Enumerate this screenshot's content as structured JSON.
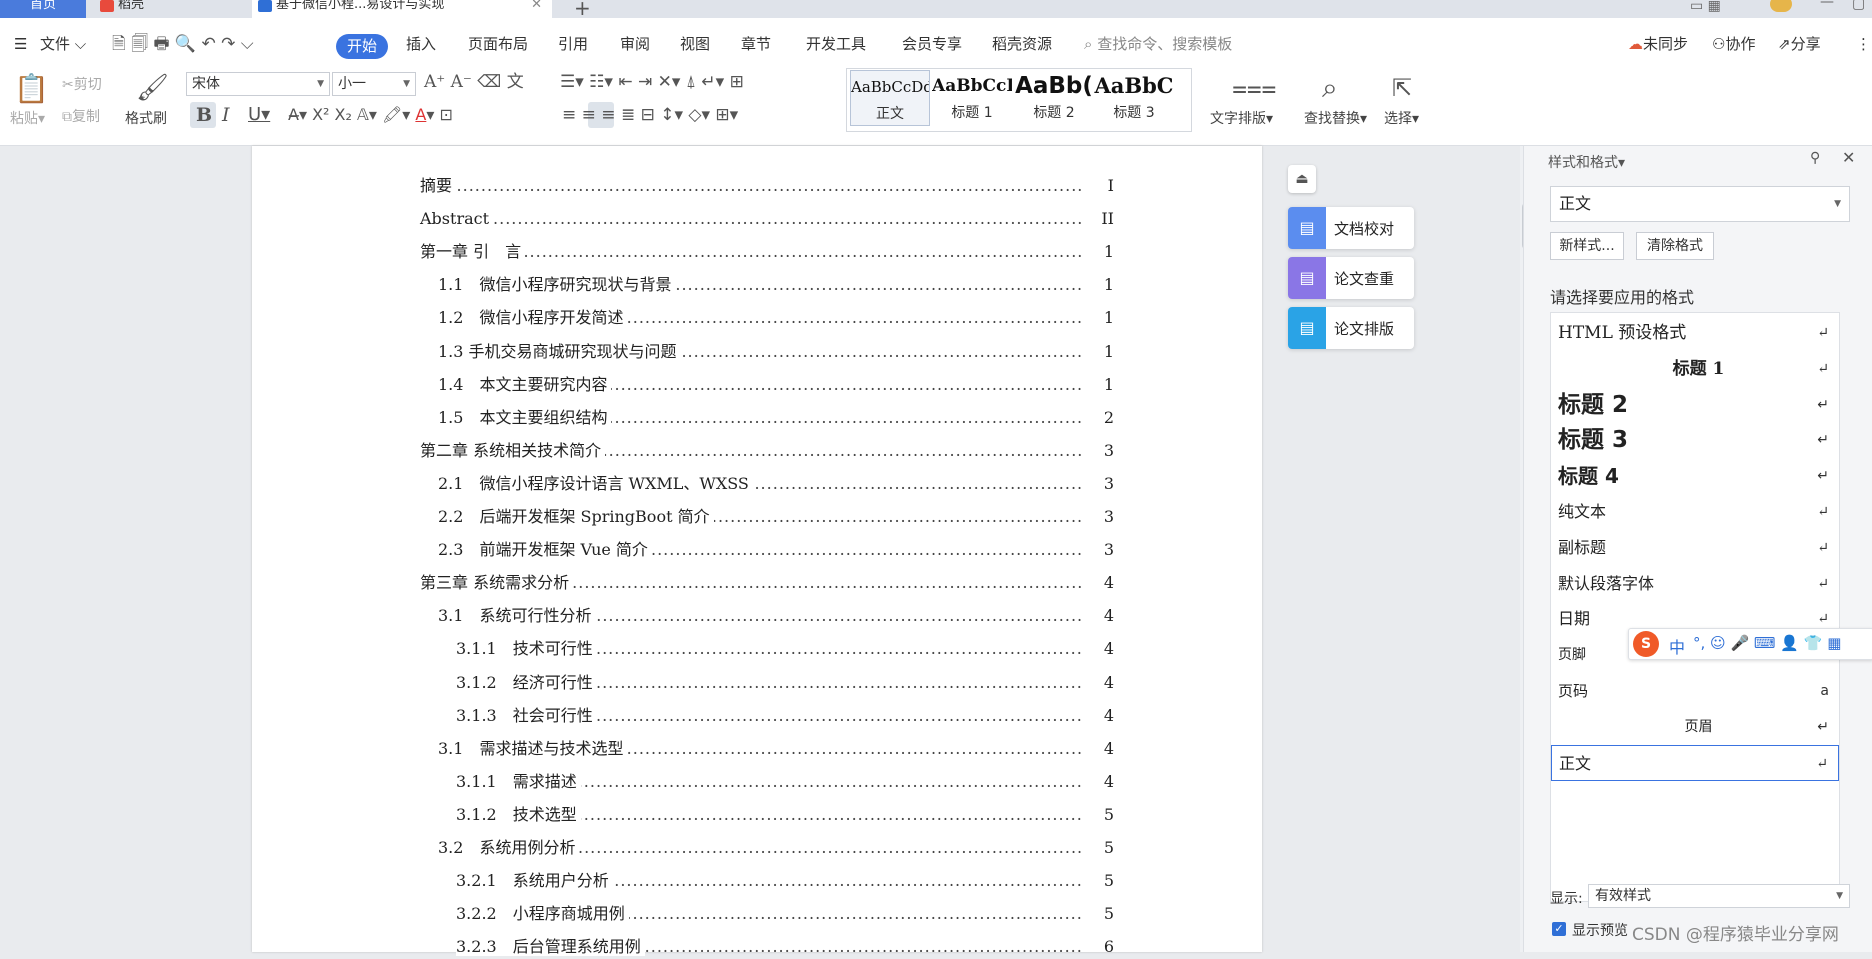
{
  "tabs": {
    "home": "首页",
    "daoke": "稻壳",
    "doc": "基于微信小程...易设计与实现"
  },
  "menu": {
    "file": "文件",
    "items": [
      "开始",
      "插入",
      "页面布局",
      "引用",
      "审阅",
      "视图",
      "章节",
      "开发工具",
      "会员专享",
      "稻壳资源"
    ],
    "search_placeholder": "查找命令、搜索模板",
    "sync": "未同步",
    "collab": "协作",
    "share": "分享"
  },
  "toolbar": {
    "paste": "粘贴",
    "cut": "剪切",
    "copy": "复制",
    "format_painter": "格式刷",
    "font": "宋体",
    "size": "小一",
    "styles": [
      {
        "preview": "AaBbCcDd",
        "label": "正文"
      },
      {
        "preview": "AaBbCcI",
        "label": "标题 1"
      },
      {
        "preview": "AaBb(",
        "label": "标题 2"
      },
      {
        "preview": "AaBbC",
        "label": "标题 3"
      }
    ],
    "text_layout": "文字排版",
    "find_replace": "查找替换",
    "select": "选择"
  },
  "toc": [
    {
      "t": "摘要",
      "p": "I"
    },
    {
      "t": "Abstract",
      "p": "II"
    },
    {
      "t": "第一章 引　言",
      "p": "1"
    },
    {
      "t": "1.1　微信小程序研究现状与背景",
      "p": "1"
    },
    {
      "t": "1.2　微信小程序开发简述",
      "p": "1"
    },
    {
      "t": "1.3 手机交易商城研究现状与问题",
      "p": "1"
    },
    {
      "t": "1.4　本文主要研究内容",
      "p": "1"
    },
    {
      "t": "1.5　本文主要组织结构",
      "p": "2"
    },
    {
      "t": "第二章 系统相关技术简介",
      "p": "3"
    },
    {
      "t": "2.1　微信小程序设计语言 WXML、WXSS",
      "p": "3"
    },
    {
      "t": "2.2　后端开发框架 SpringBoot 简介",
      "p": "3"
    },
    {
      "t": "2.3　前端开发框架 Vue 简介",
      "p": "3"
    },
    {
      "t": "第三章 系统需求分析",
      "p": "4"
    },
    {
      "t": "3.1　系统可行性分析",
      "p": "4"
    },
    {
      "t": "3.1.1　技术可行性",
      "p": "4"
    },
    {
      "t": "3.1.2　经济可行性",
      "p": "4"
    },
    {
      "t": "3.1.3　社会可行性",
      "p": "4"
    },
    {
      "t": "3.1　需求描述与技术选型",
      "p": "4"
    },
    {
      "t": "3.1.1　需求描述",
      "p": "4"
    },
    {
      "t": "3.1.2　技术选型",
      "p": "5"
    },
    {
      "t": "3.2　系统用例分析",
      "p": "5"
    },
    {
      "t": "3.2.1　系统用户分析",
      "p": "5"
    },
    {
      "t": "3.2.2　小程序商城用例",
      "p": "5"
    },
    {
      "t": "3.2.3　后台管理系统用例",
      "p": "6"
    }
  ],
  "float_buttons": [
    "文档校对",
    "论文查重",
    "论文排版"
  ],
  "pane": {
    "title": "样式和格式",
    "current": "正文",
    "new_style": "新样式...",
    "clear_format": "清除格式",
    "prompt": "请选择要应用的格式",
    "styles": [
      "HTML 预设格式",
      "标题 1",
      "标题 2",
      "标题 3",
      "标题 4",
      "纯文本",
      "副标题",
      "默认段落字体",
      "日期",
      "页脚",
      "页码",
      "页眉",
      "正文"
    ],
    "show_label": "显示:",
    "show_value": "有效样式",
    "preview_label": "显示预览"
  },
  "watermark": "CSDN @程序猿毕业分享网",
  "ime": "中"
}
